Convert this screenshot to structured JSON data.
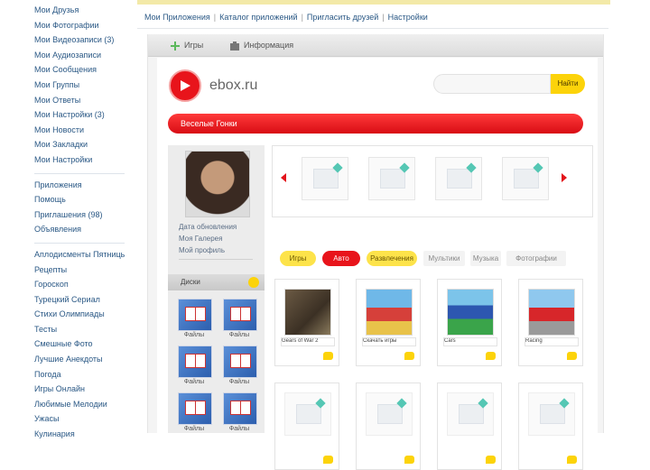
{
  "sidebar": {
    "groups": [
      [
        "Мои Друзья",
        "Мои Фотографии",
        "Мои Видеозаписи (3)",
        "Мои Аудиозаписи",
        "Мои Сообщения",
        "Мои Группы",
        "Мои Ответы",
        "Мои Настройки (3)",
        "Мои Новости",
        "Мои Закладки",
        "Мои Настройки"
      ],
      [
        "Приложения",
        "Помощь",
        "Приглашения (98)",
        "Объявления"
      ],
      [
        "Аплодисменты Пятницы",
        "Рецепты",
        "Гороскоп",
        "Турецкий Сериал",
        "Стихи Олимпиады",
        "Тесты",
        "Смешные Фото",
        "Лучшие Анекдоты",
        "Погода",
        "Игры Онлайн",
        "Любимые Мелодии",
        "Ужасы",
        "Кулинария"
      ]
    ]
  },
  "breadcrumb": [
    "Мои Приложения",
    "Каталог приложений",
    "Пригласить друзей",
    "Настройки"
  ],
  "toolbar": {
    "btn1": "Игры",
    "btn2": "Информация"
  },
  "site": {
    "brand": "ebox.ru",
    "search_button": "Найти",
    "banner": "Веселые Гонки"
  },
  "profile": {
    "links": [
      "Дата обновления",
      "Моя Галерея",
      "Мой профиль"
    ],
    "files_title": "Диски",
    "file_labels": [
      "Файлы",
      "Файлы",
      "Файлы",
      "Файлы",
      "Файлы",
      "Файлы"
    ]
  },
  "filters": [
    "Игры",
    "Авто",
    "Развлечения",
    "Мультики",
    "Музыка",
    "Фотографии"
  ],
  "games": {
    "row1": [
      "Gears of War 2",
      "Скачать игры",
      "Cars",
      "Racing"
    ]
  },
  "colors": {
    "accent": "#e8141b",
    "yellow": "#fcd30a",
    "link": "#2a5885"
  },
  "icons": {
    "logo": "play-icon",
    "toolbar1": "add-icon",
    "toolbar2": "briefcase-icon"
  }
}
